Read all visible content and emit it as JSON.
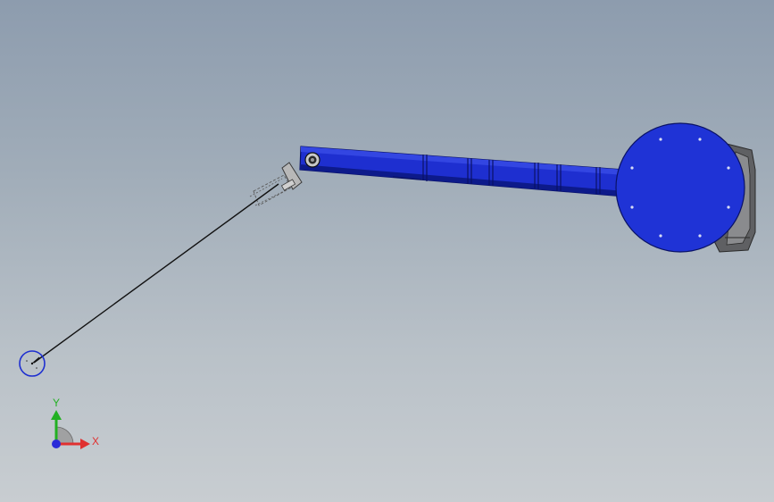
{
  "viewport": {
    "background_top": "#8d9cae",
    "background_bottom": "#c8cdd1"
  },
  "model": {
    "arm_color": "#1e2fd0",
    "arm_dark_color": "#0d1a8a",
    "hub_color": "#1f33d6",
    "motor_color": "#5f6063",
    "cable_color": "#111111",
    "pendulum_bob_color": "#1e2fd0"
  },
  "triad": {
    "x_label": "X",
    "y_label": "Y",
    "x_color": "#e03030",
    "y_color": "#22b022",
    "z_color": "#2a2ad8"
  }
}
